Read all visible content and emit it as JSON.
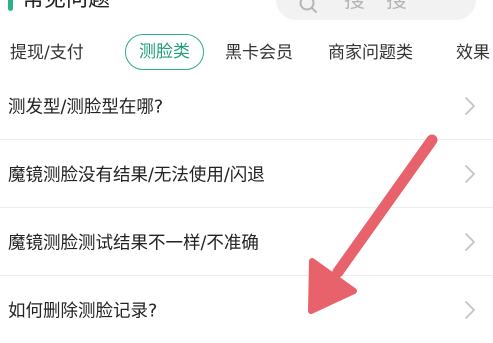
{
  "header": {
    "section_title": "常见问题",
    "search_placeholder": "搜一搜"
  },
  "tabs": [
    {
      "label": "提现/支付",
      "active": false
    },
    {
      "label": "测脸类",
      "active": true
    },
    {
      "label": "黑卡会员",
      "active": false
    },
    {
      "label": "商家问题类",
      "active": false
    },
    {
      "label": "效果",
      "active": false
    }
  ],
  "faq": [
    {
      "label": "测发型/测脸型在哪?"
    },
    {
      "label": "魔镜测脸没有结果/无法使用/闪退"
    },
    {
      "label": "魔镜测脸测试结果不一样/不准确"
    },
    {
      "label": "如何删除测脸记录?"
    }
  ],
  "colors": {
    "accent": "#2bb08a",
    "annotation_arrow": "#e8626b"
  }
}
